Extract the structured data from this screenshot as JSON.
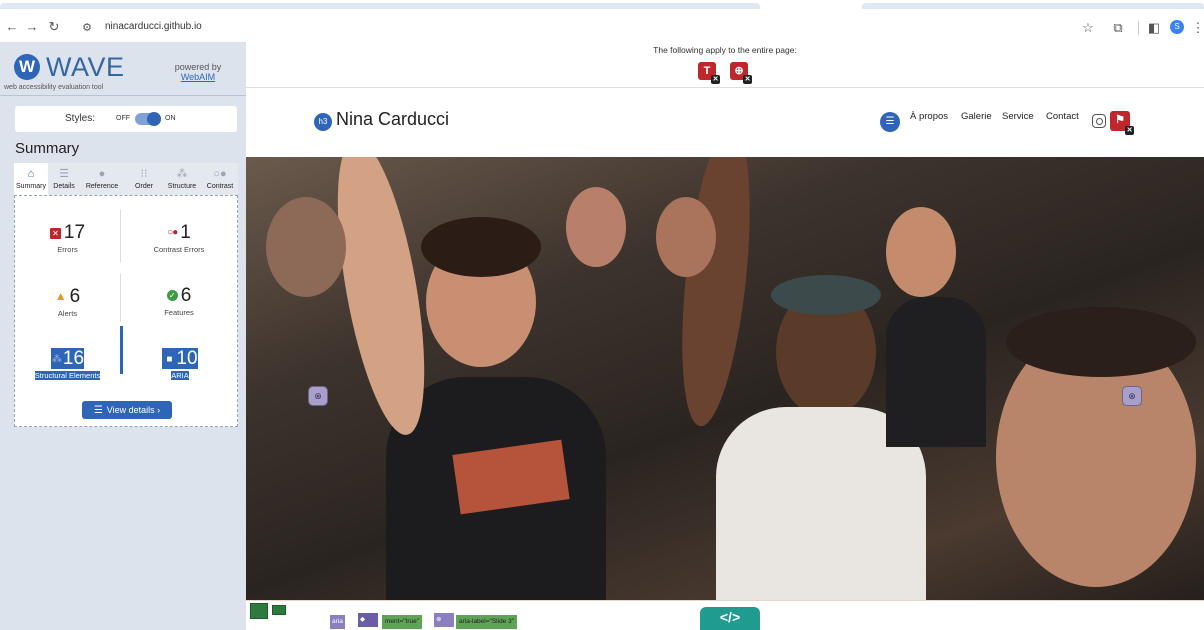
{
  "browser": {
    "url": "ninacarducci.github.io",
    "profile_initial": "S",
    "nav_icons": [
      "back-arrow",
      "forward-arrow",
      "reload"
    ],
    "toolbar_icons": [
      "star",
      "extensions",
      "side-panel"
    ]
  },
  "wave": {
    "logo_letter": "W",
    "logo_word": "WAVE",
    "subtitle": "web accessibility evaluation tool",
    "powered_by": "powered by",
    "webaim": "WebAIM",
    "styles_label": "Styles:",
    "styles_off": "OFF",
    "styles_on": "ON",
    "styles_enabled": true,
    "summary_title": "Summary",
    "tabs": [
      {
        "label": "Summary",
        "icon": "home-icon",
        "active": true
      },
      {
        "label": "Details",
        "icon": "list-icon",
        "active": false
      },
      {
        "label": "Reference",
        "icon": "info-icon",
        "active": false
      },
      {
        "label": "Order",
        "icon": "order-icon",
        "active": false
      },
      {
        "label": "Structure",
        "icon": "structure-icon",
        "active": false
      },
      {
        "label": "Contrast",
        "icon": "contrast-icon",
        "active": false
      }
    ],
    "stats": {
      "errors": {
        "count": "17",
        "label": "Errors"
      },
      "contrast_errors": {
        "count": "1",
        "label": "Contrast Errors"
      },
      "alerts": {
        "count": "6",
        "label": "Alerts"
      },
      "features": {
        "count": "6",
        "label": "Features"
      },
      "structural": {
        "count": "16",
        "label": "Structural Elements"
      },
      "aria": {
        "count": "10",
        "label": "ARIA"
      }
    },
    "view_details": "View details ›"
  },
  "page": {
    "notice": "The following apply to the entire page:",
    "notice_icons": [
      {
        "name": "page-title-error-icon",
        "glyph": "T"
      },
      {
        "name": "language-error-icon",
        "glyph": "⊕"
      }
    ],
    "heading_badge": "h3",
    "site_title": "Nina Carducci",
    "nav": [
      "À propos",
      "Galerie",
      "Service",
      "Contact"
    ],
    "footer_tags": [
      "aria",
      "ment=\"true\"",
      "aria-label=\"Slide 3\""
    ],
    "code_badge": "</>",
    "colors": {
      "wave_blue": "#2e65b6",
      "error_red": "#c0272d",
      "alert_orange": "#e89b10",
      "feature_green": "#3f9b43",
      "aria_purple": "#8b7fc0"
    }
  }
}
